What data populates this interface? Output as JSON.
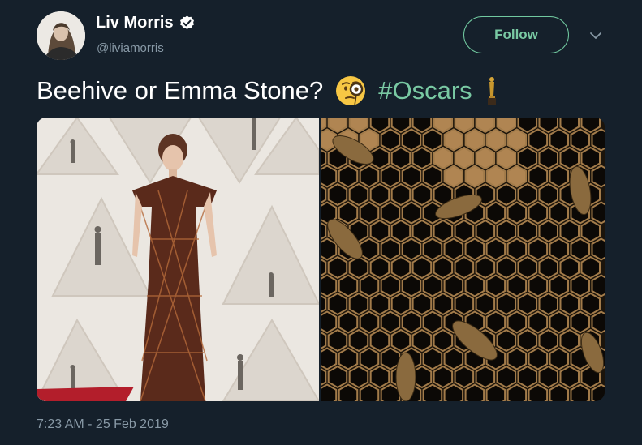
{
  "author": {
    "display_name": "Liv Morris",
    "handle": "@liviamorris",
    "verified_icon": "verified-badge-icon"
  },
  "follow_label": "Follow",
  "tweet": {
    "text": "Beehive or Emma Stone?",
    "emoji": "face-with-monocle",
    "hashtag": "#Oscars",
    "trailing_emoji": "oscar-statuette"
  },
  "media": {
    "left_image": "red-carpet-photo",
    "right_image": "honeycomb-bees-photo"
  },
  "timestamp": "7:23 AM - 25 Feb 2019",
  "colors": {
    "background": "#15202b",
    "accent": "#79c9a3",
    "secondary_text": "#8899a6"
  }
}
